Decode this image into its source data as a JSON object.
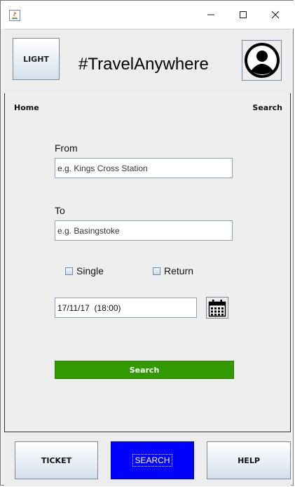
{
  "window": {
    "controls": {
      "minimize": "minimize-icon",
      "maximize": "maximize-icon",
      "close": "close-icon"
    }
  },
  "header": {
    "theme_button": "LIGHT",
    "title": "#TravelAnywhere",
    "profile_icon": "user-avatar-icon"
  },
  "nav": {
    "home": "Home",
    "search": "Search"
  },
  "form": {
    "from_label": "From",
    "from_placeholder": "e.g. Kings Cross Station",
    "to_label": "To",
    "to_placeholder": "e.g. Basingstoke",
    "single_label": "Single",
    "single_checked": false,
    "return_label": "Return",
    "return_checked": false,
    "datetime_value": "17/11/17  (18:00)",
    "calendar_icon": "calendar-icon",
    "submit_label": "Search",
    "submit_color": "#339900"
  },
  "bottom_nav": {
    "ticket": "TICKET",
    "search": "SEARCH",
    "help": "HELP",
    "active_color": "#0000ff"
  }
}
